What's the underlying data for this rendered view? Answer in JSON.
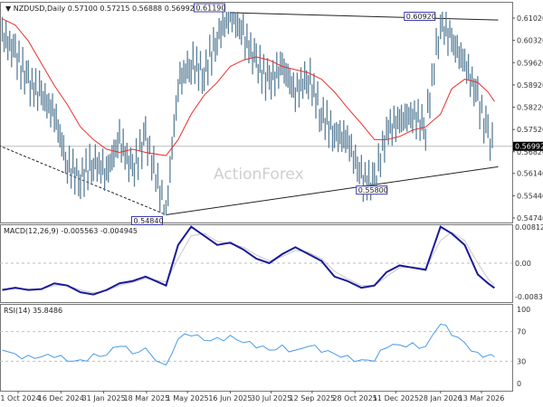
{
  "chart_data": [
    {
      "type": "ohlc",
      "title": "NZDUSD,Daily",
      "ohlc_header": [
        "0.57100",
        "0.57215",
        "0.56888",
        "0.56992"
      ],
      "watermark": "ActionForex",
      "yticks": [
        "0.61020",
        "0.60320",
        "0.59620",
        "0.58920",
        "0.58220",
        "0.57520",
        "0.56820",
        "0.56140",
        "0.55440",
        "0.54740"
      ],
      "ylim": [
        0.5466,
        0.613
      ],
      "current_price": "0.56992",
      "colors": {
        "bars": "#5a7f99",
        "ma": "#e8302a",
        "price_tag": "#000000"
      },
      "annotations": [
        {
          "text": "0.61190",
          "date": "2025-06-16",
          "price": 0.6119
        },
        {
          "text": "0.60920",
          "date": "2026-01-28",
          "price": 0.6092
        },
        {
          "text": "0.55800",
          "date": "2025-11-18",
          "price": 0.558
        },
        {
          "text": "0.54840",
          "date": "2025-04-08",
          "price": 0.5484
        }
      ],
      "trendlines": [
        {
          "style": "solid",
          "from": [
            "2025-06-16",
            0.6119
          ],
          "to": [
            "2026-03-31",
            0.6096
          ]
        },
        {
          "style": "solid",
          "from": [
            "2025-04-08",
            0.5484
          ],
          "to": [
            "2026-03-31",
            0.5635
          ]
        },
        {
          "style": "dashed",
          "from": [
            "2024-10-10",
            0.5702
          ],
          "to": [
            "2025-04-08",
            0.5484
          ]
        }
      ],
      "dates": [
        "2024-10-14",
        "2024-10-28",
        "2024-11-11",
        "2024-11-25",
        "2024-12-09",
        "2024-12-23",
        "2025-01-06",
        "2025-01-20",
        "2025-02-03",
        "2025-02-17",
        "2025-03-03",
        "2025-03-17",
        "2025-04-08",
        "2025-04-21",
        "2025-05-05",
        "2025-05-19",
        "2025-06-02",
        "2025-06-16",
        "2025-06-30",
        "2025-07-14",
        "2025-07-28",
        "2025-08-11",
        "2025-08-25",
        "2025-09-08",
        "2025-09-22",
        "2025-10-06",
        "2025-10-20",
        "2025-11-04",
        "2025-11-18",
        "2025-12-01",
        "2025-12-15",
        "2025-12-29",
        "2026-01-12",
        "2026-01-28",
        "2026-02-09",
        "2026-02-23",
        "2026-03-09",
        "2026-03-20",
        "2026-03-27"
      ],
      "close": [
        0.605,
        0.599,
        0.59,
        0.586,
        0.58,
        0.564,
        0.56,
        0.565,
        0.562,
        0.572,
        0.562,
        0.573,
        0.5484,
        0.59,
        0.596,
        0.593,
        0.604,
        0.6119,
        0.605,
        0.596,
        0.59,
        0.595,
        0.587,
        0.592,
        0.58,
        0.574,
        0.572,
        0.56,
        0.558,
        0.575,
        0.578,
        0.58,
        0.576,
        0.6092,
        0.603,
        0.596,
        0.585,
        0.573,
        0.56992
      ],
      "ma": [
        0.61,
        0.608,
        0.603,
        0.596,
        0.589,
        0.583,
        0.576,
        0.572,
        0.569,
        0.568,
        0.569,
        0.568,
        0.567,
        0.572,
        0.58,
        0.586,
        0.59,
        0.595,
        0.597,
        0.598,
        0.597,
        0.595,
        0.594,
        0.593,
        0.591,
        0.587,
        0.582,
        0.577,
        0.572,
        0.572,
        0.573,
        0.575,
        0.576,
        0.58,
        0.588,
        0.591,
        0.59,
        0.587,
        0.584
      ],
      "xticks": [
        "31 Oct 2024",
        "16 Dec 2024",
        "31 Jan 2025",
        "18 Mar 2025",
        "1 May 2025",
        "16 Jun 2025",
        "30 Jul 2025",
        "12 Sep 2025",
        "28 Oct 2025",
        "11 Dec 2025",
        "28 Jan 2026",
        "13 Mar 2026"
      ],
      "xtick_dates": [
        "2024-10-31",
        "2024-12-16",
        "2025-01-31",
        "2025-03-18",
        "2025-05-01",
        "2025-06-16",
        "2025-07-30",
        "2025-09-12",
        "2025-10-28",
        "2025-12-11",
        "2026-01-28",
        "2026-03-13"
      ]
    },
    {
      "type": "line",
      "title": "MACD(12,26,9) -0.005563 -0.004945",
      "yticks": [
        "0.008126",
        "0.00",
        "-0.008301"
      ],
      "ylim": [
        -0.008301,
        0.008126
      ],
      "colors": {
        "macd": "#1a1a9a",
        "signal": "#c8c8c8"
      },
      "macd": [
        -0.006,
        -0.0055,
        -0.006,
        -0.0058,
        -0.0045,
        -0.005,
        -0.0065,
        -0.007,
        -0.006,
        -0.0045,
        -0.004,
        -0.003,
        -0.005,
        0.004,
        0.008,
        0.006,
        0.004,
        0.0045,
        0.003,
        0.001,
        0.0,
        0.002,
        0.0035,
        0.002,
        0.0005,
        -0.003,
        -0.004,
        -0.0055,
        -0.005,
        -0.002,
        -0.0005,
        -0.001,
        -0.0015,
        0.008,
        0.0065,
        0.004,
        -0.0025,
        -0.0045,
        -0.005563
      ],
      "signal": [
        -0.0058,
        -0.0057,
        -0.0058,
        -0.0058,
        -0.005,
        -0.005,
        -0.006,
        -0.0066,
        -0.0062,
        -0.005,
        -0.0043,
        -0.0034,
        -0.0042,
        0.001,
        0.006,
        0.0065,
        0.0048,
        0.0042,
        0.0035,
        0.0018,
        0.0005,
        0.0015,
        0.0028,
        0.0024,
        0.001,
        -0.0018,
        -0.0035,
        -0.005,
        -0.005,
        -0.003,
        -0.001,
        -0.0008,
        -0.0012,
        0.005,
        0.0068,
        0.005,
        0.0,
        -0.0035,
        -0.004945
      ]
    },
    {
      "type": "line",
      "title": "RSI(14) 35.8486",
      "yticks": [
        "100",
        "70",
        "30",
        "0"
      ],
      "ylim": [
        0,
        100
      ],
      "colors": {
        "rsi": "#4a9be8",
        "levels": "#c0c0c0"
      },
      "rsi": [
        45,
        40,
        38,
        36,
        35,
        30,
        32,
        40,
        38,
        50,
        40,
        48,
        25,
        60,
        64,
        58,
        62,
        65,
        55,
        48,
        45,
        52,
        45,
        50,
        42,
        40,
        38,
        32,
        30,
        48,
        52,
        55,
        50,
        80,
        65,
        55,
        42,
        38,
        35.8486
      ]
    }
  ]
}
